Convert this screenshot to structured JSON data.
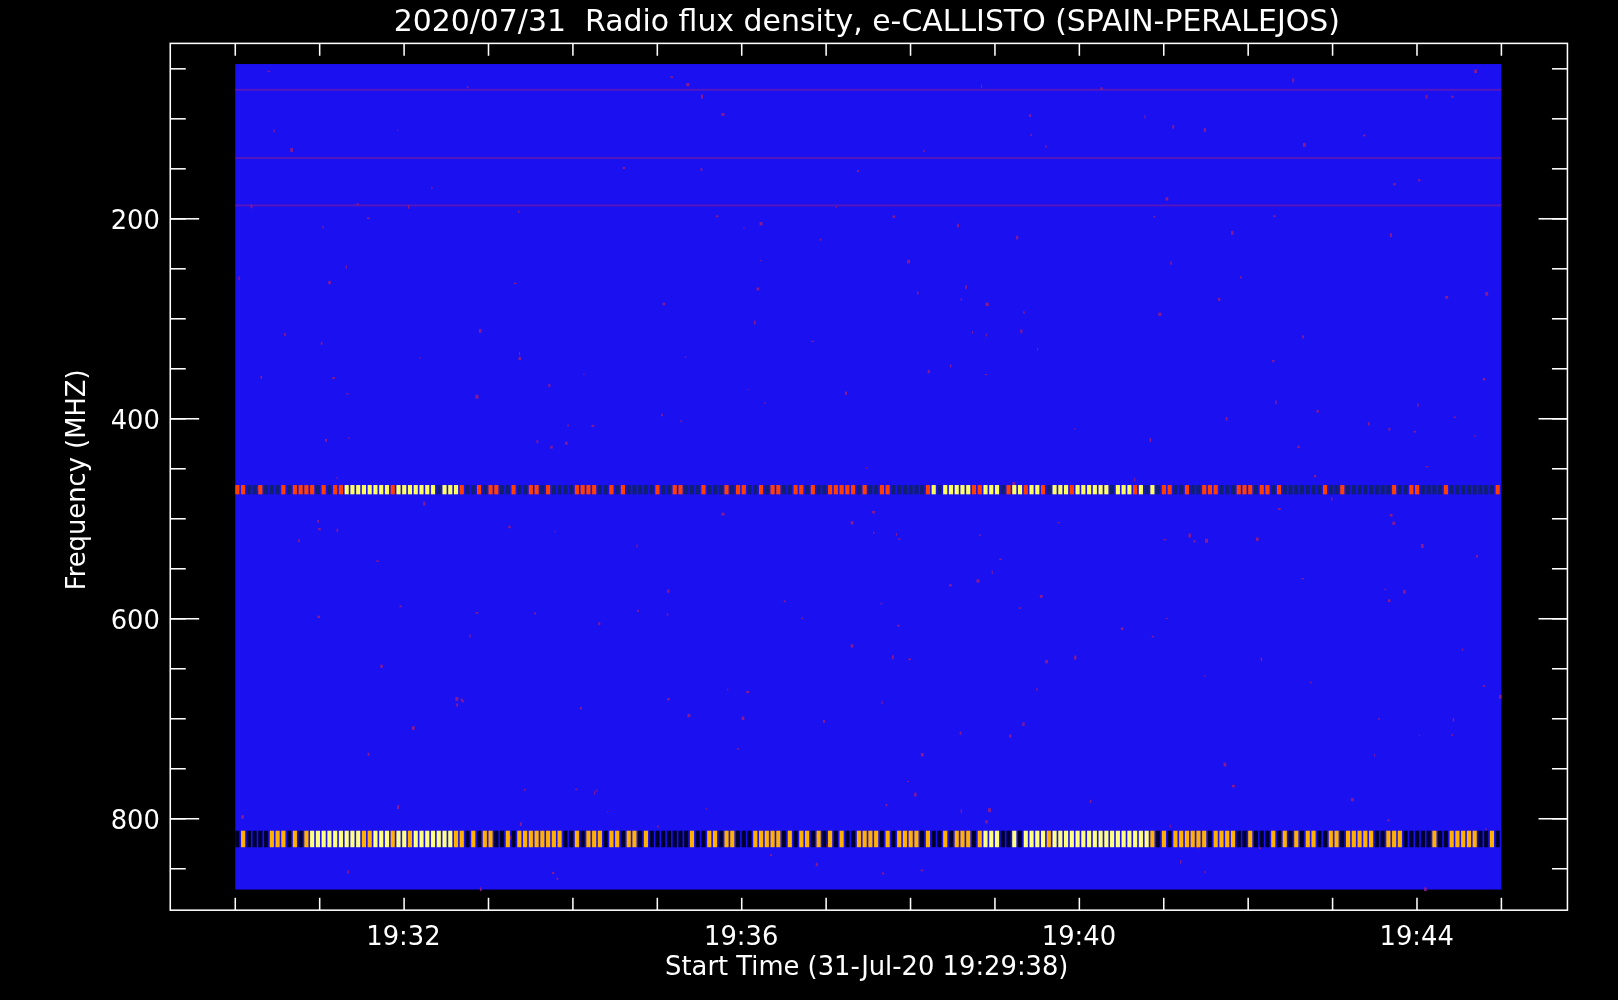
{
  "title": "2020/07/31  Radio flux density, e-CALLISTO (SPAIN-PERALEJOS)",
  "ylabel": "Frequency (MHZ)",
  "xlabel": "Start Time (31-Jul-20 19:29:38)",
  "yticks": [
    "200",
    "400",
    "600",
    "800"
  ],
  "xticks": [
    "19:32",
    "19:36",
    "19:40",
    "19:44"
  ]
}
